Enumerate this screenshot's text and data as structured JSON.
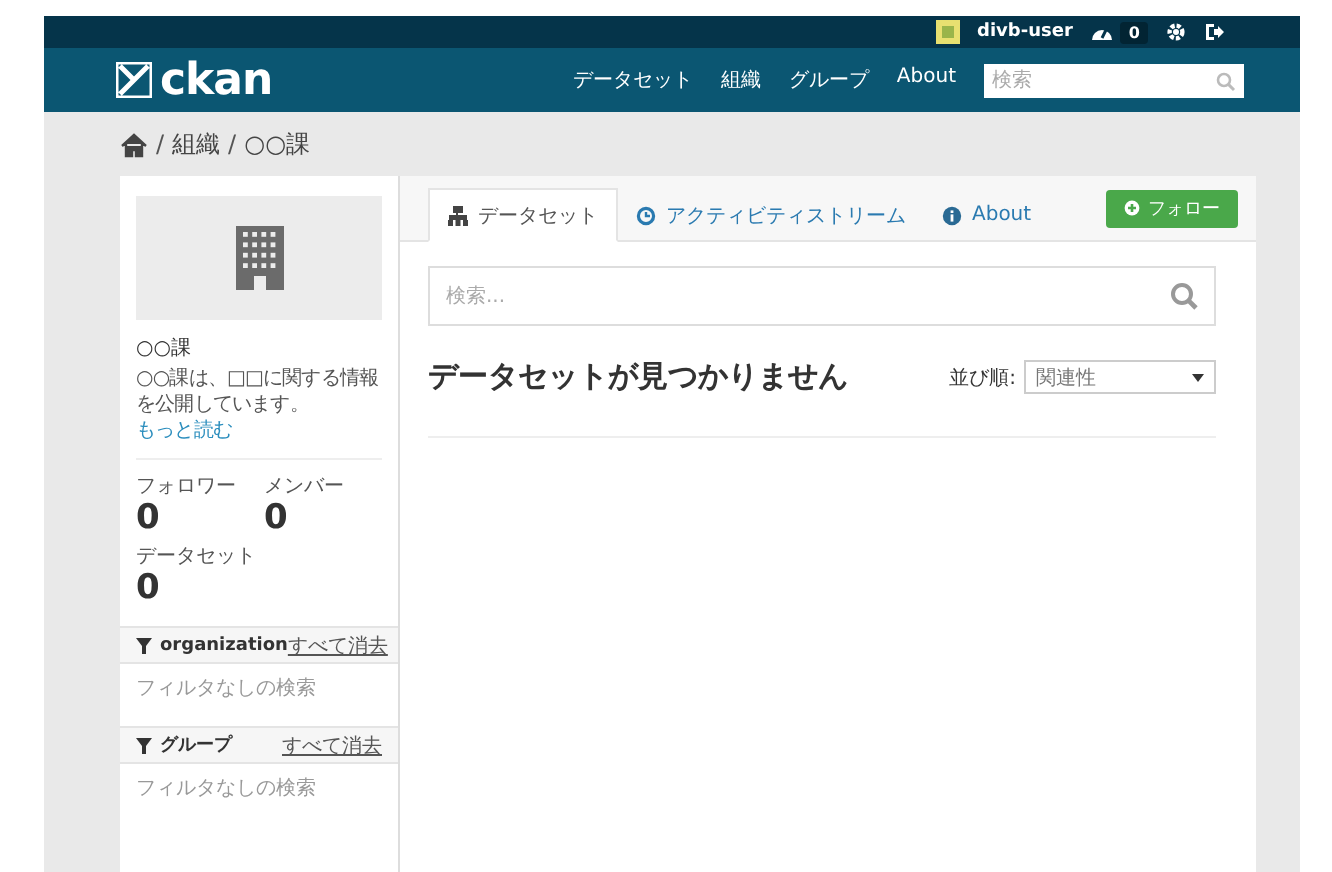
{
  "topbar": {
    "user": "divb-user",
    "dashboard_count": "0"
  },
  "header": {
    "logo": "ckan",
    "nav": [
      "データセット",
      "組織",
      "グループ",
      "About"
    ],
    "search": {
      "placeholder": "検索"
    }
  },
  "breadcrumb": [
    {
      "separator": "/",
      "label": "組織"
    },
    {
      "separator": "/",
      "label": "○○課"
    }
  ],
  "sidebar": {
    "name": "○○課",
    "description": "○○課は、□□に関する情報を公開しています。",
    "read_more": "もっと読む",
    "stats": [
      {
        "label": "フォロワー",
        "value": "0"
      },
      {
        "label": "メンバー",
        "value": "0"
      },
      {
        "label": "データセット",
        "value": "0"
      }
    ],
    "facets": [
      {
        "title": "organization",
        "clear": "すべて消去",
        "empty": "フィルタなしの検索"
      },
      {
        "title": "グループ",
        "clear": "すべて消去",
        "empty": "フィルタなしの検索"
      }
    ]
  },
  "main": {
    "tabs": [
      {
        "label": "データセット",
        "selected": true
      },
      {
        "label": "アクティビティストリーム",
        "selected": false
      },
      {
        "label": "About",
        "selected": false
      }
    ],
    "follow_button": "フォロー",
    "search": {
      "placeholder": "検索..."
    },
    "heading": "データセットが見つかりません",
    "sort_label": "並び順:",
    "sort_value": "関連性"
  }
}
